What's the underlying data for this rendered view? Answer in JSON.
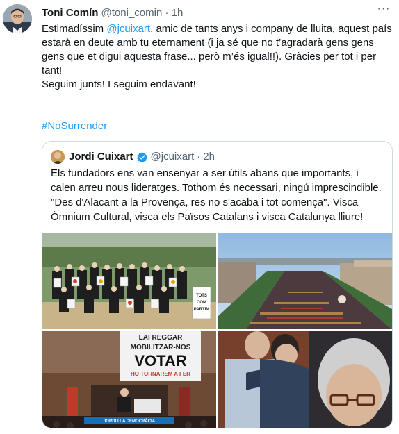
{
  "tweet": {
    "author_name": "Toni Comín",
    "author_handle": "@toni_comin",
    "separator": "·",
    "time": "1h",
    "more_label": "···",
    "text_p1_before": "Estimadíssim ",
    "text_p1_mention": "@jcuixart",
    "text_p1_after": ", amic de tants anys i company de lluita, aquest país estarà en deute amb tu eternament (i ja sé que no t’agradarà gens gens gens que et digui aquesta frase... però m’és igual!!). Gràcies per tot i per tant!",
    "text_p2": "Seguim junts! I seguim endavant!",
    "hashtag": "#NoSurrender"
  },
  "quote": {
    "author_name": "Jordi Cuixart",
    "author_handle": "@jcuixart",
    "separator": "·",
    "time": "2h",
    "text": "Els fundadors ens van ensenyar a ser útils abans que importants, i calen arreu nous lideratges. Tothom és necessari, ningú imprescindible. \"Des d'Alacant a la Provença, res no s'acaba i tot comença\". Visca Òmnium Cultural, visca els Països Catalans i visca Catalunya lliure!",
    "photos": {
      "photo3_sign_line1": "LAI REGGAR",
      "photo3_sign_line2": "MOBILITZAR-NOS",
      "photo3_sign_line3": "VOTAR",
      "photo3_sign_line4": "HO TORNAREM A FER",
      "photo3_banner": "JORDI I LA DEMOCRÀCIA",
      "photo1_sign": "TOTS COM PARTIM"
    }
  },
  "colors": {
    "link": "#1d9bf0",
    "secondary_text": "#536471",
    "border": "#cfd9de",
    "verified": "#1d9bf0"
  }
}
